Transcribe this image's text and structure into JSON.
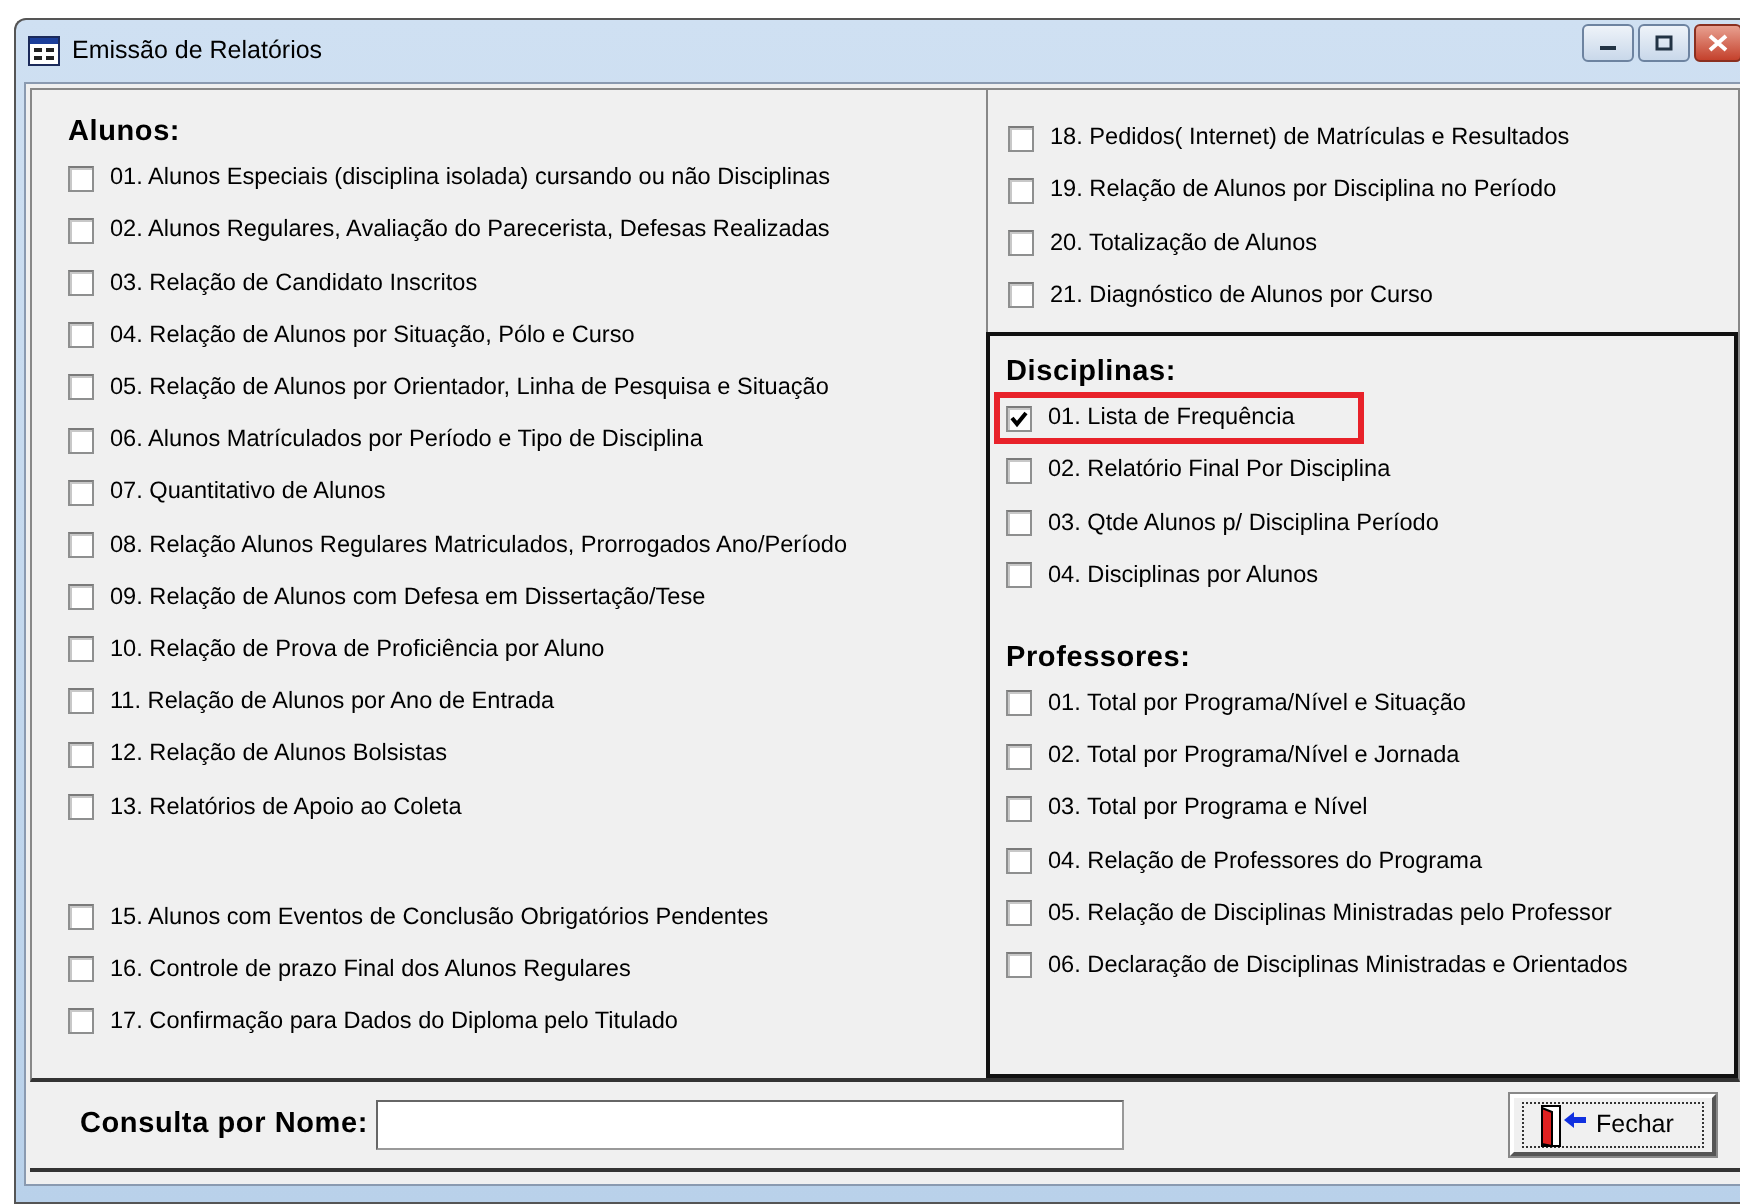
{
  "window": {
    "title": "Emissão de Relatórios"
  },
  "alunos": {
    "heading": "Alunos:",
    "items": [
      {
        "label": "01. Alunos Especiais (disciplina isolada) cursando ou não Disciplinas",
        "checked": false
      },
      {
        "label": "02. Alunos Regulares, Avaliação do Parecerista, Defesas Realizadas",
        "checked": false
      },
      {
        "label": "03. Relação de Candidato Inscritos",
        "checked": false
      },
      {
        "label": "04. Relação de Alunos por Situação, Pólo e Curso",
        "checked": false
      },
      {
        "label": "05. Relação de Alunos por Orientador, Linha de Pesquisa e Situação",
        "checked": false
      },
      {
        "label": "06. Alunos Matrículados por Período e Tipo de Disciplina",
        "checked": false
      },
      {
        "label": "07. Quantitativo de Alunos",
        "checked": false
      },
      {
        "label": "08. Relação  Alunos Regulares Matriculados, Prorrogados Ano/Período",
        "checked": false
      },
      {
        "label": "09. Relação de Alunos com Defesa em Dissertação/Tese",
        "checked": false
      },
      {
        "label": "10. Relação de Prova de Proficiência por Aluno",
        "checked": false
      },
      {
        "label": "11. Relação de Alunos por Ano de Entrada",
        "checked": false
      },
      {
        "label": "12. Relação de Alunos Bolsistas",
        "checked": false
      },
      {
        "label": "13. Relatórios de Apoio ao Coleta",
        "checked": false
      },
      {
        "label": "15. Alunos com Eventos de Conclusão Obrigatórios Pendentes",
        "checked": false,
        "gap_before": true
      },
      {
        "label": "16. Controle de prazo Final dos Alunos Regulares",
        "checked": false
      },
      {
        "label": "17. Confirmação para Dados do Diploma pelo Titulado",
        "checked": false
      }
    ],
    "more_items": [
      {
        "label": "18. Pedidos( Internet) de Matrículas e Resultados",
        "checked": false
      },
      {
        "label": "19. Relação de Alunos por Disciplina no Período",
        "checked": false
      },
      {
        "label": "20. Totalização de Alunos",
        "checked": false
      },
      {
        "label": "21. Diagnóstico de Alunos por Curso",
        "checked": false
      }
    ]
  },
  "disciplinas": {
    "heading": "Disciplinas:",
    "items": [
      {
        "label": "01. Lista de Frequência",
        "checked": true,
        "highlighted": true
      },
      {
        "label": "02. Relatório Final Por Disciplina",
        "checked": false,
        "highlighted": false
      },
      {
        "label": "03. Qtde Alunos p/ Disciplina Período",
        "checked": false,
        "highlighted": false
      },
      {
        "label": "04. Disciplinas por Alunos",
        "checked": false,
        "highlighted": false
      }
    ]
  },
  "professores": {
    "heading": "Professores:",
    "items": [
      {
        "label": "01. Total por Programa/Nível e Situação",
        "checked": false
      },
      {
        "label": "02. Total por Programa/Nível  e Jornada",
        "checked": false
      },
      {
        "label": "03. Total por Programa e Nível",
        "checked": false
      },
      {
        "label": "04. Relação de Professores do Programa",
        "checked": false
      },
      {
        "label": "05. Relação de Disciplinas Ministradas pelo Professor",
        "checked": false
      },
      {
        "label": "06. Declaração de Disciplinas Ministradas e Orientados",
        "checked": false
      }
    ]
  },
  "search": {
    "label": "Consulta por Nome:"
  },
  "buttons": [
    {
      "label": "Fechar",
      "kind": "close"
    }
  ]
}
